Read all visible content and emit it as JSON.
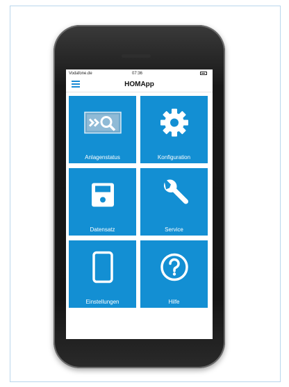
{
  "status": {
    "carrier": "Vodafone.de",
    "time": "07:36"
  },
  "header": {
    "title": "HOMApp"
  },
  "tiles": [
    {
      "label": "Anlagenstatus",
      "icon": "status-screen-icon"
    },
    {
      "label": "Konfiguration",
      "icon": "gear-icon"
    },
    {
      "label": "Datensatz",
      "icon": "floppy-disk-icon"
    },
    {
      "label": "Service",
      "icon": "wrench-icon"
    },
    {
      "label": "Einstellungen",
      "icon": "smartphone-icon"
    },
    {
      "label": "Hilfe",
      "icon": "help-icon"
    }
  ],
  "colors": {
    "tile": "#138fd3",
    "accent": "#1a8ad4"
  }
}
